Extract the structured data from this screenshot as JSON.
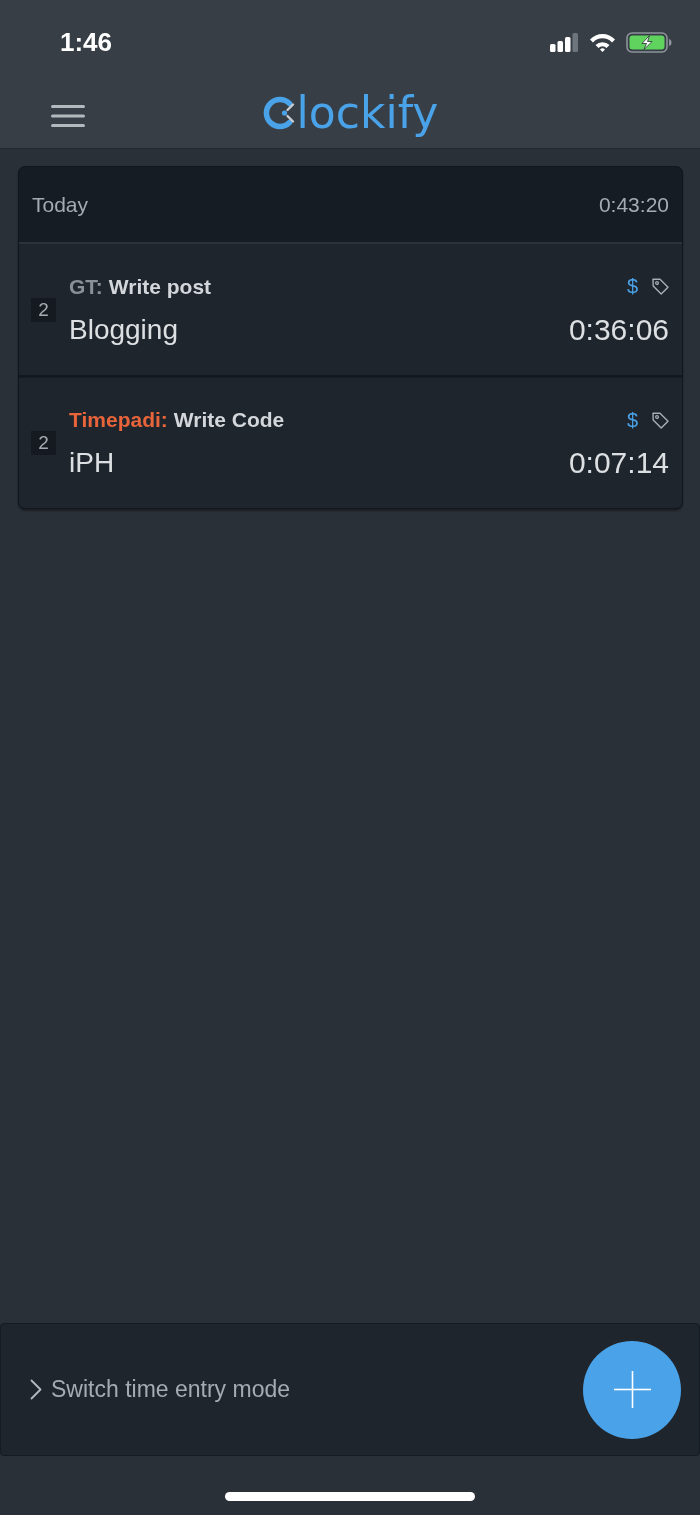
{
  "status_bar": {
    "time": "1:46"
  },
  "header": {
    "logo_text": "lockify"
  },
  "day_group": {
    "label": "Today",
    "total": "0:43:20",
    "entries": [
      {
        "count": "2",
        "project": "GT:",
        "color": "#8b8f96",
        "task": "Write post",
        "billable": true,
        "billable_symbol": "$",
        "description": "Blogging",
        "duration": "0:36:06"
      },
      {
        "count": "2",
        "project": "Timepadi:",
        "color": "#e8643a",
        "task": "Write Code",
        "billable": true,
        "billable_symbol": "$",
        "description": "iPH",
        "duration": "0:07:14"
      }
    ]
  },
  "bottom_bar": {
    "mode_toggle": "Switch time entry mode"
  }
}
